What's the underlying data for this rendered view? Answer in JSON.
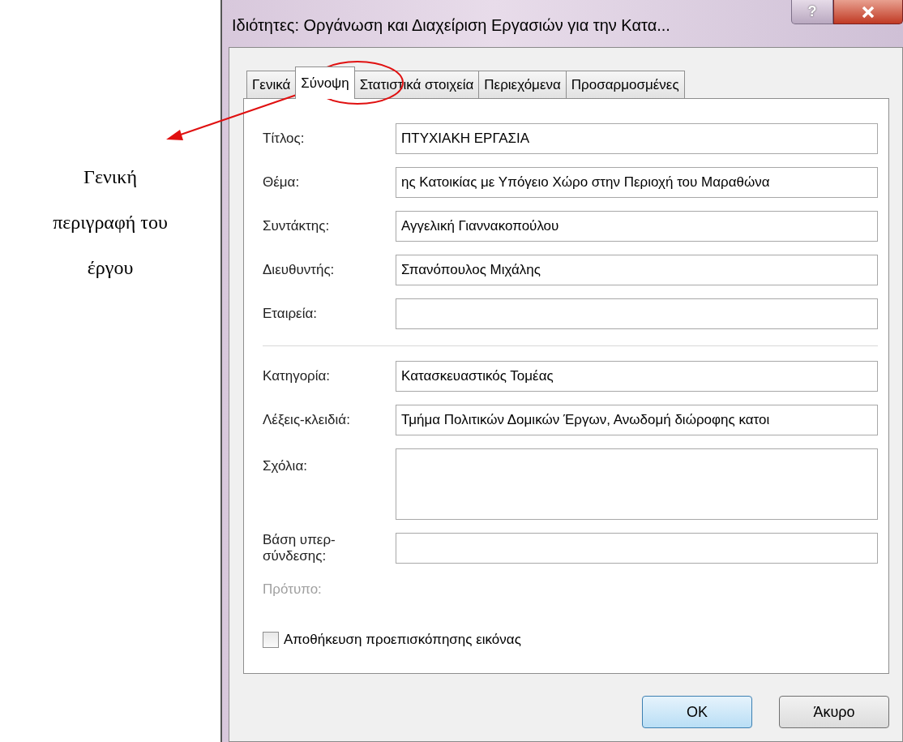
{
  "annotation": {
    "lines": [
      "Γενική",
      "περιγραφή του",
      "έργου"
    ]
  },
  "window": {
    "title": "Ιδιότητες: Οργάνωση και Διαχείριση Εργασιών για την Κατα...",
    "help": "?"
  },
  "tabs": [
    {
      "label": "Γενικά",
      "selected": false
    },
    {
      "label": "Σύνοψη",
      "selected": true
    },
    {
      "label": "Στατιστικά στοιχεία",
      "selected": false
    },
    {
      "label": "Περιεχόμενα",
      "selected": false
    },
    {
      "label": "Προσαρμοσμένες",
      "selected": false
    }
  ],
  "sections": [
    [
      {
        "kind": "text",
        "label": "Τίτλος:",
        "value": "ΠΤΥΧΙΑΚΗ ΕΡΓΑΣΙΑ"
      },
      {
        "kind": "text",
        "label": "Θέμα:",
        "value": "ης Κατοικίας με Υπόγειο Χώρο στην Περιοχή του Μαραθώνα"
      },
      {
        "kind": "text",
        "label": "Συντάκτης:",
        "value": "Αγγελική Γιαννακοπούλου"
      },
      {
        "kind": "text",
        "label": "Διευθυντής:",
        "value": "Σπανόπουλος Μιχάλης"
      },
      {
        "kind": "text",
        "label": "Εταιρεία:"
      }
    ],
    [
      {
        "kind": "text",
        "label": "Κατηγορία:",
        "value": "Κατασκευαστικός Τομέας"
      },
      {
        "kind": "text",
        "label": "Λέξεις-κλειδιά:",
        "value": "Τμήμα Πολιτικών Δομικών Έργων, Ανωδομή διώροφης κατοι"
      },
      {
        "kind": "textarea",
        "label": "Σχόλια:"
      },
      {
        "kind": "text",
        "label": "Βάση υπερ-σύνδεσης:"
      }
    ]
  ],
  "template": {
    "label": "Πρότυπο:",
    "disabled": true
  },
  "preview_checkbox": {
    "label": "Αποθήκευση προεπισκόπησης εικόνας",
    "checked": false
  },
  "buttons": [
    {
      "label": "OK",
      "kind": "default"
    },
    {
      "label": "Άκυρο",
      "kind": "normal"
    }
  ]
}
